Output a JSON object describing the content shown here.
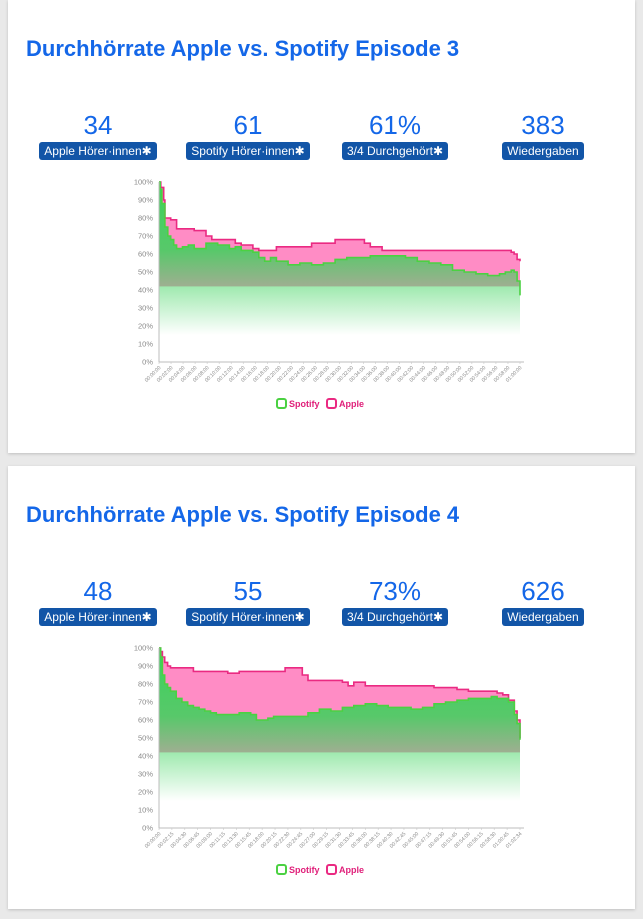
{
  "colors": {
    "title": "#1467e8",
    "badge": "#1255a7",
    "spotify_line": "#4bd142",
    "spotify_fill": "#3ad35a",
    "apple_line": "#ea2a82",
    "apple_fill": "#ff7fbf",
    "legend_text": "#e0207a"
  },
  "cards": [
    {
      "title": "Durchhörrate Apple vs. Spotify Episode 3",
      "stats": [
        {
          "value": "34",
          "label": "Apple Hörer·innen✱"
        },
        {
          "value": "61",
          "label": "Spotify Hörer·innen✱"
        },
        {
          "value": "61%",
          "label": "3/4 Durchgehört✱"
        },
        {
          "value": "383",
          "label": "Wiedergaben"
        }
      ],
      "legend": [
        "Spotify",
        "Apple"
      ]
    },
    {
      "title": "Durchhörrate Apple vs. Spotify Episode 4",
      "stats": [
        {
          "value": "48",
          "label": "Apple Hörer·innen✱"
        },
        {
          "value": "55",
          "label": "Spotify Hörer·innen✱"
        },
        {
          "value": "73%",
          "label": "3/4 Durchgehört✱"
        },
        {
          "value": "626",
          "label": "Wiedergaben"
        }
      ],
      "legend": [
        "Spotify",
        "Apple"
      ]
    }
  ],
  "chart_data": [
    {
      "type": "area",
      "title": "Durchhörrate Apple vs. Spotify Episode 3",
      "xlabel": "",
      "ylabel": "",
      "ylim": [
        0,
        100
      ],
      "y_ticks": [
        "100%",
        "90%",
        "80%",
        "70%",
        "60%",
        "50%",
        "40%",
        "30%",
        "20%",
        "10%",
        "0%"
      ],
      "x_ticks": [
        "00:00:00",
        "00:02:00",
        "00:04:00",
        "00:06:00",
        "00:08:00",
        "00:10:00",
        "00:12:00",
        "00:14:00",
        "00:16:00",
        "00:18:00",
        "00:20:00",
        "00:22:00",
        "00:24:00",
        "00:26:00",
        "00:28:00",
        "00:30:00",
        "00:32:00",
        "00:34:00",
        "00:36:00",
        "00:38:00",
        "00:40:00",
        "00:42:00",
        "00:44:00",
        "00:46:00",
        "00:48:00",
        "00:50:00",
        "00:52:00",
        "00:54:00",
        "00:56:00",
        "00:58:00",
        "01:00:00"
      ],
      "x_range": [
        0,
        61.5
      ],
      "grid": false,
      "legend_position": "bottom",
      "series": [
        {
          "name": "Spotify",
          "x": [
            0,
            0.2,
            0.5,
            1,
            1.5,
            2,
            2.5,
            3,
            4,
            5,
            6,
            8,
            10,
            12,
            13,
            14,
            15,
            16,
            17,
            18,
            19,
            20,
            22,
            24,
            25,
            26,
            28,
            30,
            32,
            34,
            36,
            38,
            40,
            42,
            44,
            46,
            48,
            50,
            52,
            54,
            56,
            58,
            59,
            60,
            60.5,
            61,
            61.5
          ],
          "values": [
            100,
            96,
            88,
            75,
            70,
            68,
            65,
            63,
            64,
            65,
            63,
            66,
            65,
            63,
            64,
            62,
            62,
            61,
            58,
            56,
            58,
            56,
            54,
            55,
            55,
            54,
            55,
            57,
            58,
            58,
            59,
            59,
            59,
            58,
            56,
            55,
            54,
            51,
            50,
            49,
            48,
            49,
            50,
            51,
            50,
            45,
            37
          ]
        },
        {
          "name": "Apple",
          "x": [
            0,
            0.3,
            0.8,
            1,
            2,
            3,
            4,
            5,
            6,
            8,
            9,
            10,
            12,
            13,
            14,
            15,
            16,
            17,
            18,
            20,
            22,
            24,
            26,
            28,
            29,
            30,
            32,
            34,
            35,
            36,
            38,
            40,
            42,
            44,
            46,
            48,
            50,
            52,
            54,
            56,
            58,
            59,
            60,
            60.5,
            61,
            61.5
          ],
          "values": [
            100,
            97,
            90,
            80,
            79,
            74,
            74,
            74,
            73,
            70,
            68,
            68,
            68,
            66,
            65,
            65,
            63,
            62,
            62,
            64,
            64,
            64,
            66,
            66,
            66,
            68,
            68,
            68,
            66,
            64,
            62,
            62,
            62,
            62,
            62,
            62,
            62,
            62,
            62,
            62,
            62,
            62,
            61,
            60,
            57,
            56
          ]
        }
      ]
    },
    {
      "type": "area",
      "title": "Durchhörrate Apple vs. Spotify Episode 4",
      "xlabel": "",
      "ylabel": "",
      "ylim": [
        0,
        100
      ],
      "y_ticks": [
        "100%",
        "90%",
        "80%",
        "70%",
        "60%",
        "50%",
        "40%",
        "30%",
        "20%",
        "10%",
        "0%"
      ],
      "x_ticks": [
        "00:00:00",
        "00:02:15",
        "00:04:30",
        "00:06:45",
        "00:09:00",
        "00:11:15",
        "00:13:30",
        "00:15:45",
        "00:18:00",
        "00:20:15",
        "00:22:30",
        "00:24:45",
        "00:27:00",
        "00:29:15",
        "00:31:30",
        "00:33:45",
        "00:36:00",
        "00:38:15",
        "00:40:30",
        "00:42:45",
        "00:45:00",
        "00:47:15",
        "00:49:30",
        "00:51:45",
        "00:54:00",
        "00:56:15",
        "00:58:30",
        "01:00:45",
        "01:02:34"
      ],
      "x_range": [
        0,
        63
      ],
      "grid": false,
      "legend_position": "bottom",
      "series": [
        {
          "name": "Spotify",
          "x": [
            0,
            0.3,
            0.6,
            1,
            1.5,
            2,
            3,
            4,
            5,
            6,
            7,
            8,
            9,
            10,
            12,
            14,
            16,
            17,
            18,
            19,
            20,
            22,
            24,
            26,
            28,
            30,
            32,
            34,
            36,
            38,
            40,
            42,
            44,
            46,
            48,
            50,
            52,
            54,
            56,
            58,
            59,
            60,
            61,
            62,
            62.5,
            63
          ],
          "values": [
            100,
            95,
            85,
            80,
            78,
            76,
            72,
            70,
            68,
            67,
            66,
            65,
            64,
            63,
            63,
            64,
            63,
            60,
            60,
            61,
            62,
            62,
            62,
            64,
            66,
            65,
            67,
            68,
            69,
            68,
            67,
            67,
            66,
            67,
            69,
            70,
            71,
            72,
            72,
            73,
            72,
            72,
            70,
            63,
            58,
            49
          ]
        },
        {
          "name": "Apple",
          "x": [
            0,
            0.3,
            0.6,
            1,
            1.5,
            2,
            3,
            4,
            5,
            6,
            8,
            10,
            12,
            13,
            14,
            16,
            18,
            20,
            22,
            23,
            24,
            25,
            26,
            28,
            30,
            32,
            33,
            34,
            35,
            36,
            38,
            40,
            42,
            44,
            46,
            48,
            50,
            52,
            54,
            56,
            58,
            59,
            60,
            61,
            62,
            62.5,
            63
          ],
          "values": [
            100,
            98,
            95,
            92,
            90,
            89,
            89,
            89,
            89,
            87,
            87,
            87,
            86,
            86,
            87,
            87,
            87,
            87,
            89,
            89,
            89,
            85,
            82,
            82,
            82,
            81,
            79,
            81,
            81,
            79,
            79,
            79,
            79,
            79,
            79,
            78,
            78,
            77,
            76,
            76,
            76,
            75,
            74,
            71,
            65,
            60,
            50
          ]
        }
      ]
    }
  ]
}
